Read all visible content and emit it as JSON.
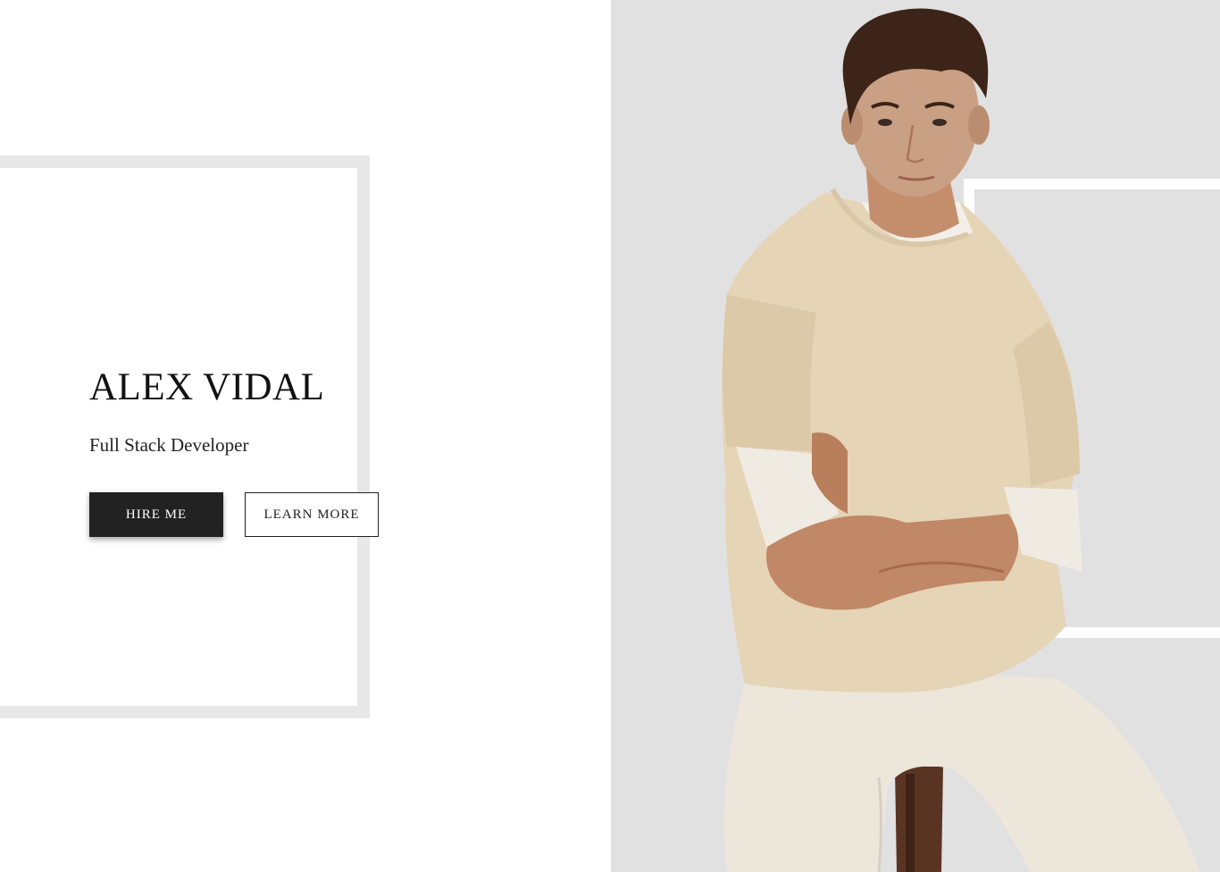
{
  "hero": {
    "name": "ALEX VIDAL",
    "role": "Full Stack Developer"
  },
  "actions": {
    "hire_label": "HIRE ME",
    "learn_label": "LEARN MORE"
  },
  "colors": {
    "left_background": "#ffffff",
    "frame_gray": "#e8e8e8",
    "right_background": "#e1e1e2",
    "button_dark": "#222222"
  },
  "portrait": {
    "icon": "person-photo-icon"
  }
}
